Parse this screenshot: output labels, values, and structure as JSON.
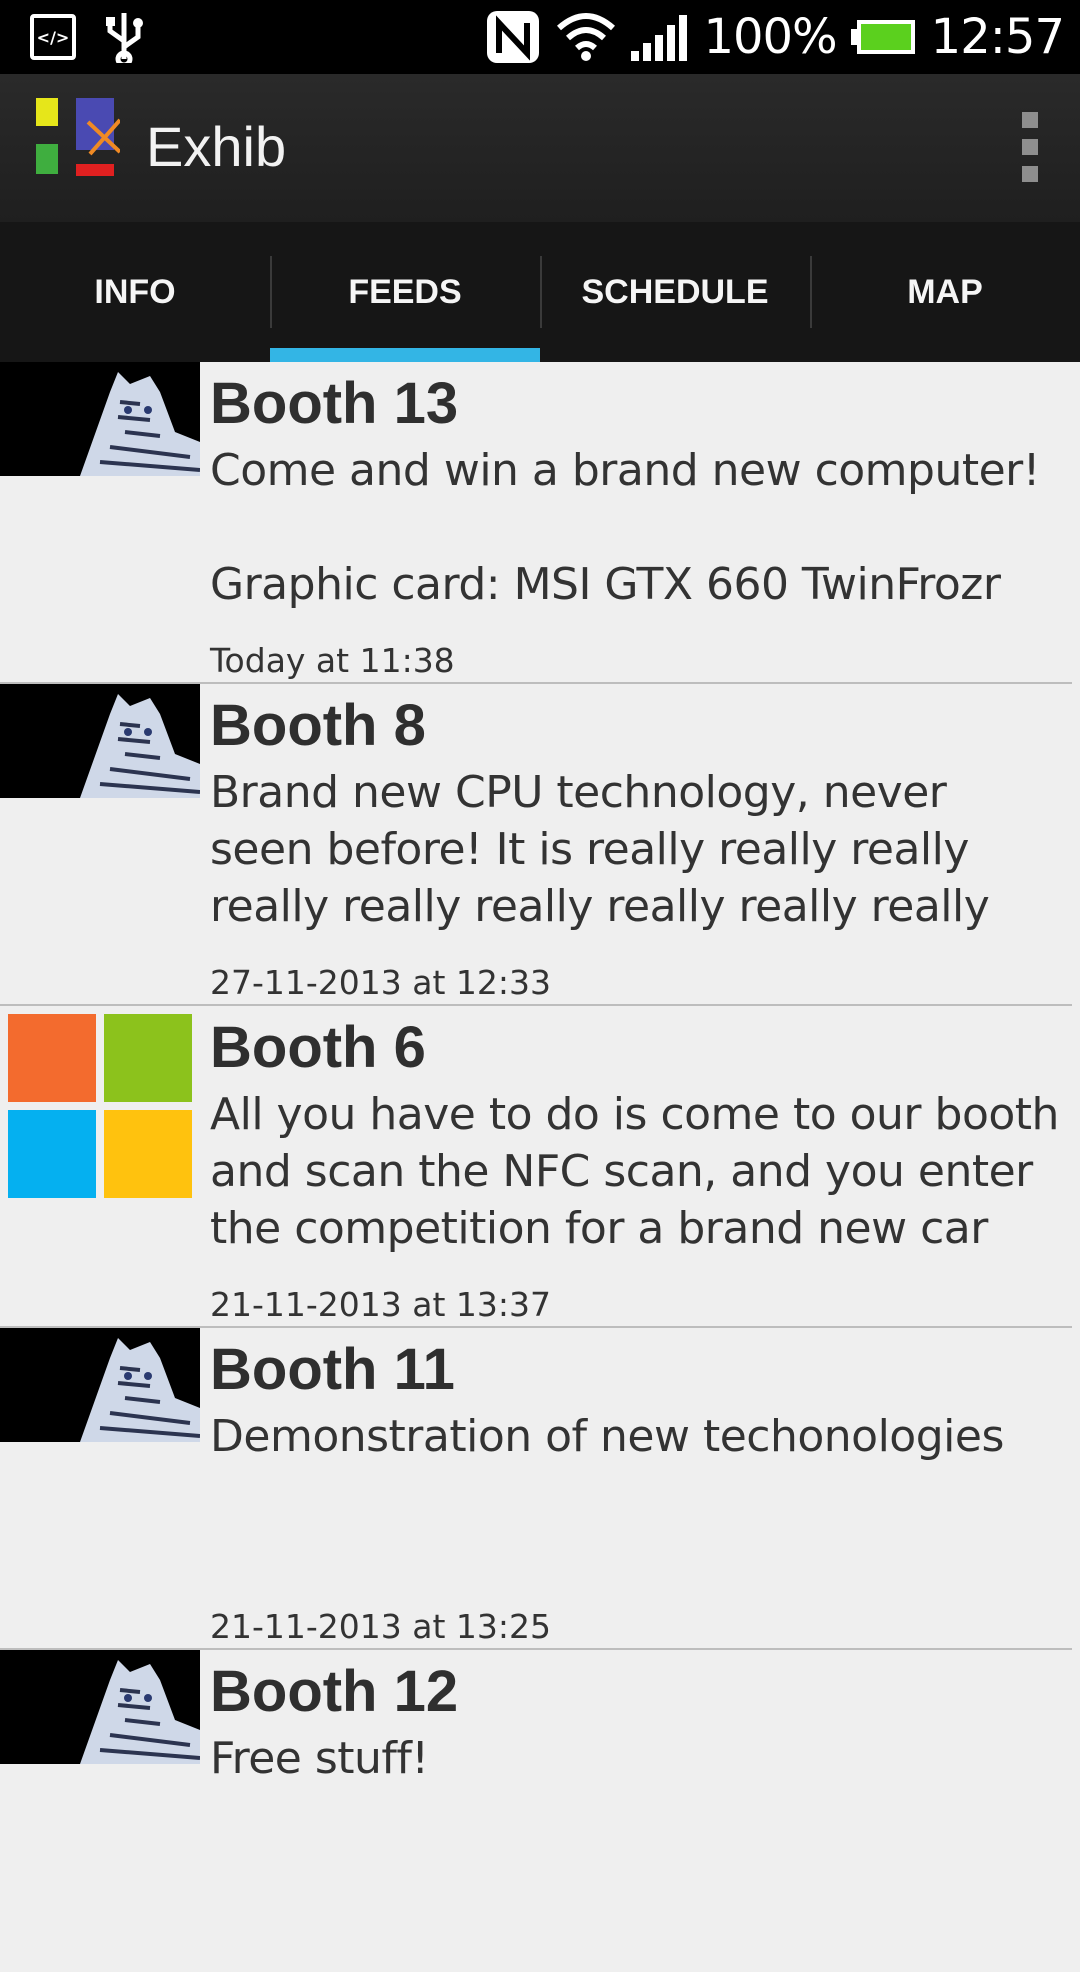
{
  "status_bar": {
    "battery": "100%",
    "time": "12:57",
    "icons": [
      "developer-icon",
      "usb-icon",
      "nfc-icon",
      "wifi-icon",
      "signal-icon",
      "battery-icon"
    ]
  },
  "app": {
    "title": "Exhib"
  },
  "tabs": [
    {
      "label": "INFO"
    },
    {
      "label": "FEEDS",
      "active": true
    },
    {
      "label": "SCHEDULE"
    },
    {
      "label": "MAP"
    }
  ],
  "feed": [
    {
      "title": "Booth 13",
      "body": "Come and win a brand new computer!\n\nGraphic card: MSI GTX 660 TwinFrozr",
      "time": "Today at 11:38",
      "thumb": "tiger"
    },
    {
      "title": "Booth 8",
      "body": "Brand new CPU technology, never seen before! It is really really really really really really really really really really",
      "time": "27-11-2013 at 12:33",
      "thumb": "tiger"
    },
    {
      "title": "Booth 6",
      "body": "All you have to do is come to our booth and scan the NFC scan, and you enter the competition for a brand new car",
      "time": "21-11-2013 at 13:37",
      "thumb": "windows-logo"
    },
    {
      "title": "Booth 11",
      "body": "Demonstration of new techonologies",
      "time": "21-11-2013 at 13:25",
      "thumb": "tiger"
    },
    {
      "title": "Booth 12",
      "body": "Free stuff!",
      "time": "",
      "thumb": "tiger"
    }
  ],
  "colors": {
    "tab_indicator": "#33b5e5",
    "action_bar": "#222222",
    "list_background": "#efefef"
  }
}
